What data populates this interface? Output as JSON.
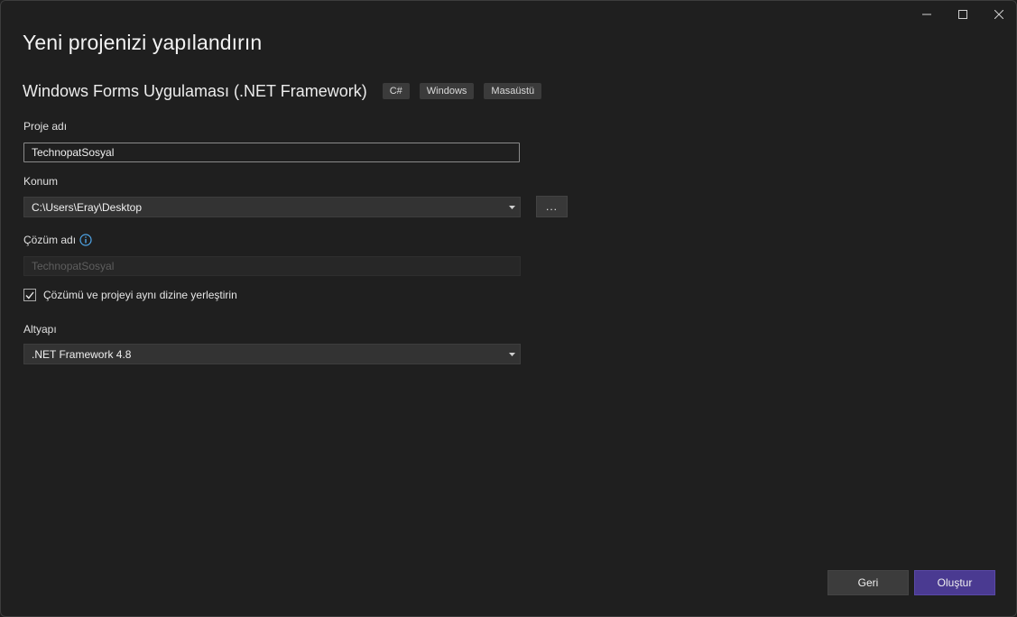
{
  "page": {
    "title": "Yeni projenizi yapılandırın"
  },
  "template": {
    "name": "Windows Forms Uygulaması (.NET Framework)",
    "tags": [
      "C#",
      "Windows",
      "Masaüstü"
    ]
  },
  "project_name": {
    "label": "Proje adı",
    "value": "TechnopatSosyal"
  },
  "location": {
    "label": "Konum",
    "value": "C:\\Users\\Eray\\Desktop",
    "browse_label": "..."
  },
  "solution_name": {
    "label": "Çözüm adı",
    "value": "TechnopatSosyal",
    "disabled": true
  },
  "same_directory": {
    "label": "Çözümü ve projeyi aynı dizine yerleştirin",
    "checked": true
  },
  "framework": {
    "label": "Altyapı",
    "value": ".NET Framework 4.8"
  },
  "footer": {
    "back_label": "Geri",
    "create_label": "Oluştur"
  },
  "icons": {
    "minimize": "minimize-icon",
    "maximize": "maximize-icon",
    "close": "close-icon",
    "info": "info-icon",
    "dropdown": "chevron-down-icon",
    "check": "check-icon"
  },
  "colors": {
    "background": "#1f1f1f",
    "accent": "#4a3a91",
    "info": "#4fa6e8"
  }
}
